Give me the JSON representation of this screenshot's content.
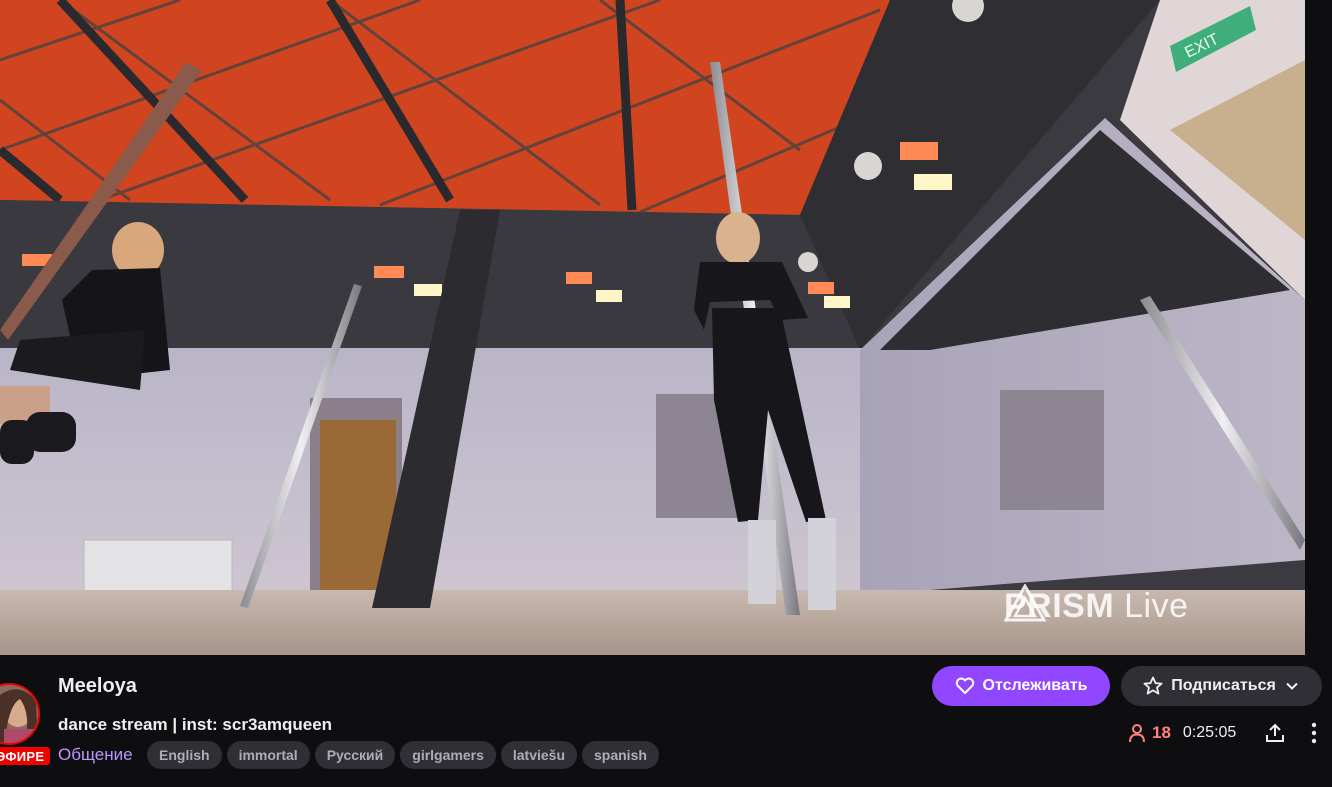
{
  "video": {
    "watermark_brand": "PRISM",
    "watermark_suffix": "Live",
    "exit_sign": "EXIT"
  },
  "channel": {
    "name": "Meeloya",
    "live_badge": "ЭФИРЕ",
    "title": "dance stream | inst: scr3amqueen",
    "category": "Общение",
    "tags": [
      "English",
      "immortal",
      "Русский",
      "girlgamers",
      "latviešu",
      "spanish"
    ]
  },
  "actions": {
    "follow_label": "Отслеживать",
    "subscribe_label": "Подписаться"
  },
  "stats": {
    "viewers": "18",
    "uptime": "0:25:05"
  },
  "icons": {
    "follow": "heart-icon",
    "subscribe": "star-icon",
    "subscribe_dropdown": "chevron-down-icon",
    "viewers": "person-icon",
    "share": "share-icon",
    "more": "more-vertical-icon"
  },
  "colors": {
    "accent": "#9147ff",
    "live": "#eb0400",
    "viewers": "#ff8280",
    "tag_bg": "#2f2f35",
    "category": "#bf94ff"
  }
}
